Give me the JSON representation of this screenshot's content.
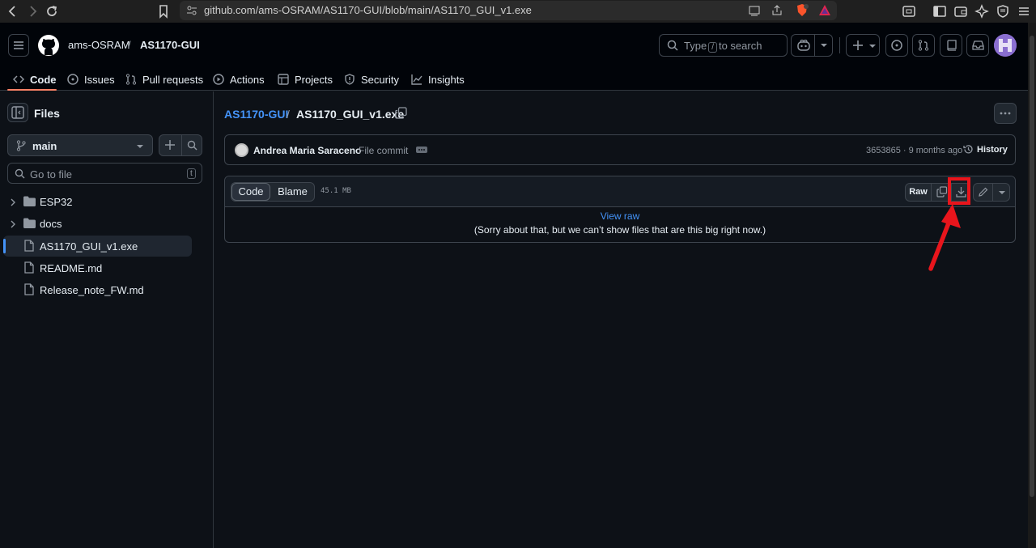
{
  "browser": {
    "url": "github.com/ams-OSRAM/AS1170-GUI/blob/main/AS1170_GUI_v1.exe"
  },
  "header": {
    "owner": "ams-OSRAM",
    "separator": "/",
    "repo": "AS1170-GUI",
    "search_placeholder_prefix": "Type",
    "search_key": "/",
    "search_placeholder_suffix": "to search"
  },
  "tabs": [
    {
      "label": "Code",
      "icon": "code-icon",
      "active": true
    },
    {
      "label": "Issues",
      "icon": "issue-icon"
    },
    {
      "label": "Pull requests",
      "icon": "pull-request-icon"
    },
    {
      "label": "Actions",
      "icon": "play-icon"
    },
    {
      "label": "Projects",
      "icon": "table-icon"
    },
    {
      "label": "Security",
      "icon": "shield-icon"
    },
    {
      "label": "Insights",
      "icon": "graph-icon"
    }
  ],
  "sidebar": {
    "title": "Files",
    "branch": "main",
    "goto_placeholder": "Go to file",
    "goto_key": "t",
    "tree": [
      {
        "label": "ESP32",
        "type": "folder"
      },
      {
        "label": "docs",
        "type": "folder"
      },
      {
        "label": "AS1170_GUI_v1.exe",
        "type": "file",
        "active": true
      },
      {
        "label": "README.md",
        "type": "file"
      },
      {
        "label": "Release_note_FW.md",
        "type": "file"
      }
    ]
  },
  "breadcrumb": {
    "repo": "AS1170-GUI",
    "separator": "/",
    "file": "AS1170_GUI_v1.exe"
  },
  "commit": {
    "author": "Andrea Maria Saraceno",
    "message": "File commit",
    "meta": "3653865 · 9 months ago",
    "history_label": "History"
  },
  "file": {
    "tab_code": "Code",
    "tab_blame": "Blame",
    "size": "45.1 MB",
    "raw_label": "Raw",
    "view_raw": "View raw",
    "too_big_message": "(Sorry about that, but we can’t show files that are this big right now.)"
  },
  "colors": {
    "accent_link": "#4493f8",
    "tab_underline": "#f78166",
    "annotation_red": "#e8151c"
  }
}
